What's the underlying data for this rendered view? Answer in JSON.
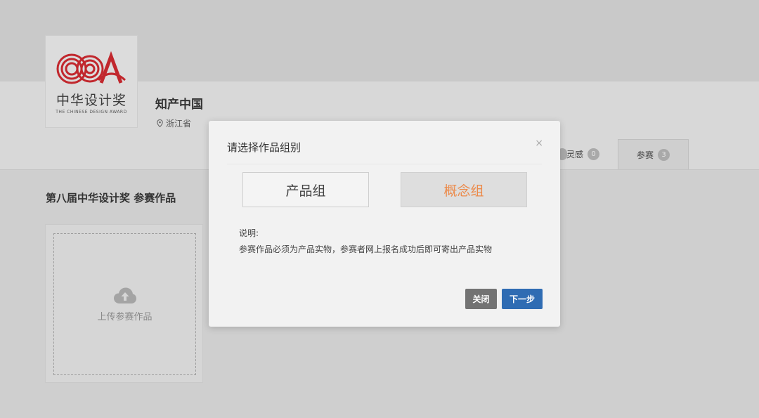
{
  "profile": {
    "logo": {
      "wordmark_cn": "中华设计奖",
      "wordmark_en": "THE CHINESE DESIGN AWARD",
      "brand_color": "#c1272d"
    },
    "name": "知产中国",
    "province": "浙江省"
  },
  "tabs": [
    {
      "label": "灵感",
      "count": "0"
    },
    {
      "label": "参赛",
      "count": "3"
    }
  ],
  "section": {
    "title": "第八届中华设计奖 参赛作品",
    "upload_label": "上传参赛作品",
    "upload_icon": "cloud-upload-icon"
  },
  "modal": {
    "title": "请选择作品组别",
    "close_glyph": "×",
    "options": [
      {
        "label": "产品组",
        "selected": false
      },
      {
        "label": "概念组",
        "selected": true
      }
    ],
    "note_label": "说明:",
    "note_text": "参赛作品必须为产品实物，参赛者网上报名成功后即可寄出产品实物",
    "buttons": {
      "close": "关闭",
      "next": "下一步"
    },
    "colors": {
      "selected_text": "#ec8a4a",
      "primary": "#2f6cb3",
      "secondary": "#737373"
    }
  }
}
